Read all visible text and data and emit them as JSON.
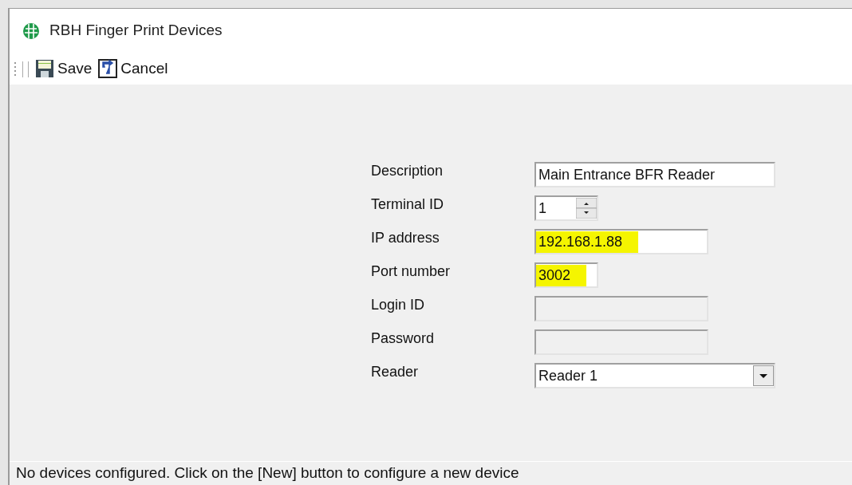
{
  "window": {
    "title": "RBH Finger Print Devices"
  },
  "toolbar": [
    {
      "kind": "save",
      "label": "Save"
    },
    {
      "kind": "cancel",
      "label": "Cancel"
    }
  ],
  "fields": [
    {
      "label": "Description",
      "kind": "text",
      "value": "Main Entrance BFR Reader",
      "disabled": false,
      "highlighted": false
    },
    {
      "label": "Terminal ID",
      "kind": "spinner",
      "value": "1",
      "disabled": false,
      "highlighted": false
    },
    {
      "label": "IP address",
      "kind": "text",
      "value": "192.168.1.88",
      "disabled": false,
      "highlighted": true
    },
    {
      "label": "Port number",
      "kind": "text",
      "value": "3002",
      "disabled": false,
      "highlighted": true
    },
    {
      "label": "Login ID",
      "kind": "text",
      "disabled": true,
      "highlighted": false
    },
    {
      "label": "Password",
      "kind": "text",
      "disabled": true,
      "highlighted": false
    },
    {
      "label": "Reader",
      "kind": "select",
      "value": "Reader 1",
      "disabled": false,
      "highlighted": false
    }
  ],
  "status_bar": "No devices configured. Click on the [New] button to configure a new device"
}
